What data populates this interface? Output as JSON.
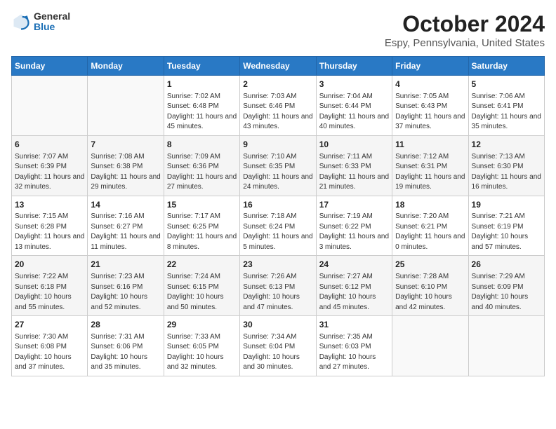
{
  "logo": {
    "line1": "General",
    "line2": "Blue"
  },
  "title": "October 2024",
  "subtitle": "Espy, Pennsylvania, United States",
  "days_of_week": [
    "Sunday",
    "Monday",
    "Tuesday",
    "Wednesday",
    "Thursday",
    "Friday",
    "Saturday"
  ],
  "weeks": [
    [
      {
        "num": "",
        "info": ""
      },
      {
        "num": "",
        "info": ""
      },
      {
        "num": "1",
        "info": "Sunrise: 7:02 AM\nSunset: 6:48 PM\nDaylight: 11 hours and 45 minutes."
      },
      {
        "num": "2",
        "info": "Sunrise: 7:03 AM\nSunset: 6:46 PM\nDaylight: 11 hours and 43 minutes."
      },
      {
        "num": "3",
        "info": "Sunrise: 7:04 AM\nSunset: 6:44 PM\nDaylight: 11 hours and 40 minutes."
      },
      {
        "num": "4",
        "info": "Sunrise: 7:05 AM\nSunset: 6:43 PM\nDaylight: 11 hours and 37 minutes."
      },
      {
        "num": "5",
        "info": "Sunrise: 7:06 AM\nSunset: 6:41 PM\nDaylight: 11 hours and 35 minutes."
      }
    ],
    [
      {
        "num": "6",
        "info": "Sunrise: 7:07 AM\nSunset: 6:39 PM\nDaylight: 11 hours and 32 minutes."
      },
      {
        "num": "7",
        "info": "Sunrise: 7:08 AM\nSunset: 6:38 PM\nDaylight: 11 hours and 29 minutes."
      },
      {
        "num": "8",
        "info": "Sunrise: 7:09 AM\nSunset: 6:36 PM\nDaylight: 11 hours and 27 minutes."
      },
      {
        "num": "9",
        "info": "Sunrise: 7:10 AM\nSunset: 6:35 PM\nDaylight: 11 hours and 24 minutes."
      },
      {
        "num": "10",
        "info": "Sunrise: 7:11 AM\nSunset: 6:33 PM\nDaylight: 11 hours and 21 minutes."
      },
      {
        "num": "11",
        "info": "Sunrise: 7:12 AM\nSunset: 6:31 PM\nDaylight: 11 hours and 19 minutes."
      },
      {
        "num": "12",
        "info": "Sunrise: 7:13 AM\nSunset: 6:30 PM\nDaylight: 11 hours and 16 minutes."
      }
    ],
    [
      {
        "num": "13",
        "info": "Sunrise: 7:15 AM\nSunset: 6:28 PM\nDaylight: 11 hours and 13 minutes."
      },
      {
        "num": "14",
        "info": "Sunrise: 7:16 AM\nSunset: 6:27 PM\nDaylight: 11 hours and 11 minutes."
      },
      {
        "num": "15",
        "info": "Sunrise: 7:17 AM\nSunset: 6:25 PM\nDaylight: 11 hours and 8 minutes."
      },
      {
        "num": "16",
        "info": "Sunrise: 7:18 AM\nSunset: 6:24 PM\nDaylight: 11 hours and 5 minutes."
      },
      {
        "num": "17",
        "info": "Sunrise: 7:19 AM\nSunset: 6:22 PM\nDaylight: 11 hours and 3 minutes."
      },
      {
        "num": "18",
        "info": "Sunrise: 7:20 AM\nSunset: 6:21 PM\nDaylight: 11 hours and 0 minutes."
      },
      {
        "num": "19",
        "info": "Sunrise: 7:21 AM\nSunset: 6:19 PM\nDaylight: 10 hours and 57 minutes."
      }
    ],
    [
      {
        "num": "20",
        "info": "Sunrise: 7:22 AM\nSunset: 6:18 PM\nDaylight: 10 hours and 55 minutes."
      },
      {
        "num": "21",
        "info": "Sunrise: 7:23 AM\nSunset: 6:16 PM\nDaylight: 10 hours and 52 minutes."
      },
      {
        "num": "22",
        "info": "Sunrise: 7:24 AM\nSunset: 6:15 PM\nDaylight: 10 hours and 50 minutes."
      },
      {
        "num": "23",
        "info": "Sunrise: 7:26 AM\nSunset: 6:13 PM\nDaylight: 10 hours and 47 minutes."
      },
      {
        "num": "24",
        "info": "Sunrise: 7:27 AM\nSunset: 6:12 PM\nDaylight: 10 hours and 45 minutes."
      },
      {
        "num": "25",
        "info": "Sunrise: 7:28 AM\nSunset: 6:10 PM\nDaylight: 10 hours and 42 minutes."
      },
      {
        "num": "26",
        "info": "Sunrise: 7:29 AM\nSunset: 6:09 PM\nDaylight: 10 hours and 40 minutes."
      }
    ],
    [
      {
        "num": "27",
        "info": "Sunrise: 7:30 AM\nSunset: 6:08 PM\nDaylight: 10 hours and 37 minutes."
      },
      {
        "num": "28",
        "info": "Sunrise: 7:31 AM\nSunset: 6:06 PM\nDaylight: 10 hours and 35 minutes."
      },
      {
        "num": "29",
        "info": "Sunrise: 7:33 AM\nSunset: 6:05 PM\nDaylight: 10 hours and 32 minutes."
      },
      {
        "num": "30",
        "info": "Sunrise: 7:34 AM\nSunset: 6:04 PM\nDaylight: 10 hours and 30 minutes."
      },
      {
        "num": "31",
        "info": "Sunrise: 7:35 AM\nSunset: 6:03 PM\nDaylight: 10 hours and 27 minutes."
      },
      {
        "num": "",
        "info": ""
      },
      {
        "num": "",
        "info": ""
      }
    ]
  ]
}
